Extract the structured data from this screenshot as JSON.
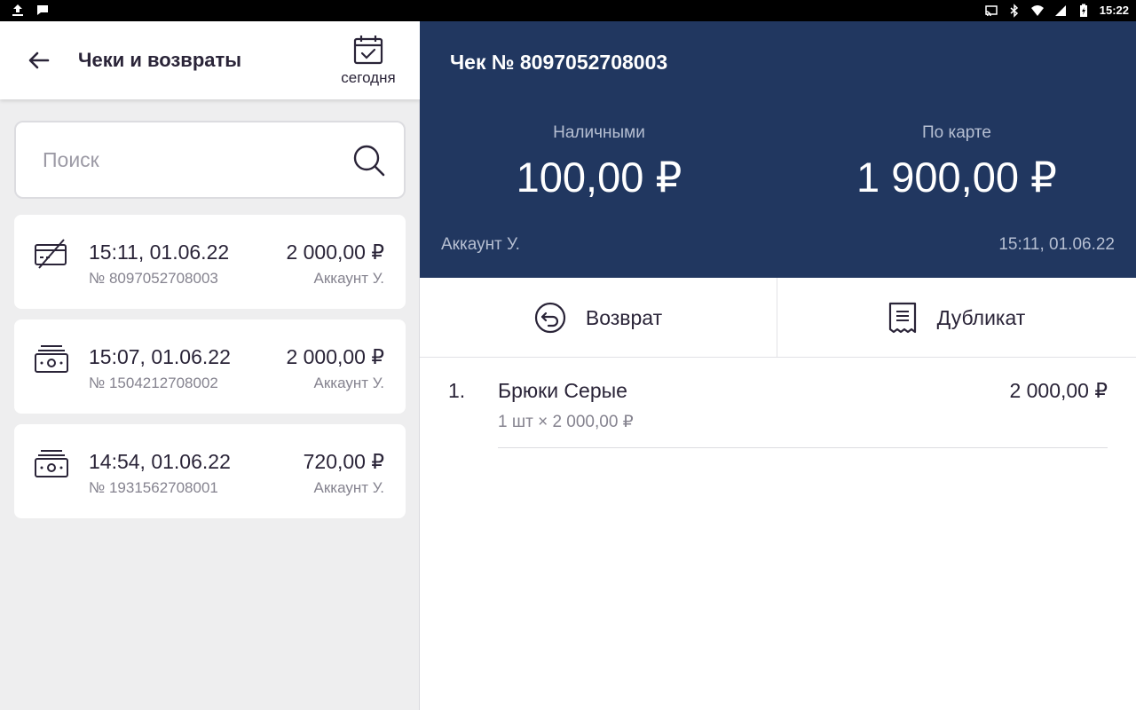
{
  "status_bar": {
    "time": "15:22",
    "left_icons": [
      "upload-icon",
      "message-icon"
    ],
    "right_icons": [
      "cast-icon",
      "bluetooth-icon",
      "wifi-icon",
      "signal-icon",
      "battery-icon"
    ]
  },
  "left_panel": {
    "title": "Чеки и возвраты",
    "date_filter_label": "сегодня",
    "search": {
      "placeholder": "Поиск",
      "value": ""
    },
    "receipts": [
      {
        "icon": "card-payment-icon",
        "time": "15:11, 01.06.22",
        "number": "№ 8097052708003",
        "amount": "2 000,00 ₽",
        "account": "Аккаунт У.",
        "selected": true
      },
      {
        "icon": "cash-payment-icon",
        "time": "15:07, 01.06.22",
        "number": "№ 1504212708002",
        "amount": "2 000,00 ₽",
        "account": "Аккаунт У.",
        "selected": false
      },
      {
        "icon": "cash-payment-icon",
        "time": "14:54, 01.06.22",
        "number": "№ 1931562708001",
        "amount": "720,00 ₽",
        "account": "Аккаунт У.",
        "selected": false
      }
    ]
  },
  "detail": {
    "title": "Чек № 8097052708003",
    "cash": {
      "label": "Наличными",
      "value": "100,00 ₽"
    },
    "card": {
      "label": "По карте",
      "value": "1 900,00 ₽"
    },
    "cashier": "Аккаунт У.",
    "datetime": "15:11, 01.06.22",
    "actions": {
      "refund_label": "Возврат",
      "duplicate_label": "Дубликат"
    },
    "items": [
      {
        "index": "1.",
        "name": "Брюки Серые",
        "price": "2 000,00 ₽",
        "qty_line": "1 шт × 2 000,00 ₽"
      }
    ]
  },
  "colors": {
    "header_bg": "#213760",
    "text_primary": "#2a2438",
    "text_secondary": "#85838f",
    "panel_bg": "#eeeeef"
  }
}
